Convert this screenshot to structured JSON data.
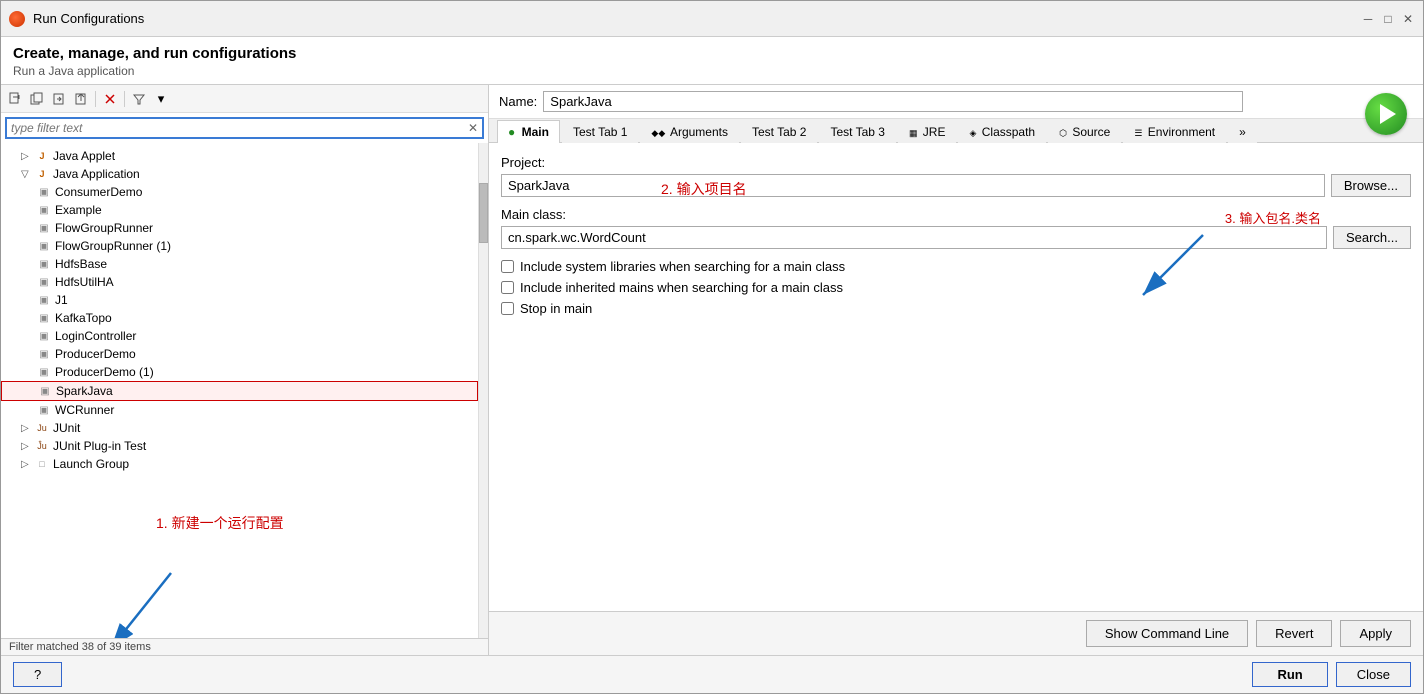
{
  "window": {
    "title": "Run Configurations",
    "header_title": "Create, manage, and run configurations",
    "header_sub": "Run a Java application"
  },
  "toolbar": {
    "new_label": "New",
    "duplicate_label": "Duplicate",
    "import_label": "Import",
    "export_label": "Export",
    "delete_label": "Delete",
    "filter_label": "Filter"
  },
  "search": {
    "placeholder": "type filter text",
    "value": "type filter text"
  },
  "tree": {
    "items": [
      {
        "id": "java-applet",
        "label": "Java Applet",
        "indent": 1,
        "type": "group",
        "expanded": false
      },
      {
        "id": "java-application",
        "label": "Java Application",
        "indent": 1,
        "type": "group",
        "expanded": true
      },
      {
        "id": "consumer-demo",
        "label": "ConsumerDemo",
        "indent": 2,
        "type": "item"
      },
      {
        "id": "example",
        "label": "Example",
        "indent": 2,
        "type": "item"
      },
      {
        "id": "flow-group-runner",
        "label": "FlowGroupRunner",
        "indent": 2,
        "type": "item"
      },
      {
        "id": "flow-group-runner-1",
        "label": "FlowGroupRunner (1)",
        "indent": 2,
        "type": "item"
      },
      {
        "id": "hdfs-base",
        "label": "HdfsBase",
        "indent": 2,
        "type": "item"
      },
      {
        "id": "hdfs-util-ha",
        "label": "HdfsUtilHA",
        "indent": 2,
        "type": "item"
      },
      {
        "id": "j1",
        "label": "J1",
        "indent": 2,
        "type": "item"
      },
      {
        "id": "kafka-topo",
        "label": "KafkaTopo",
        "indent": 2,
        "type": "item"
      },
      {
        "id": "login-controller",
        "label": "LoginController",
        "indent": 2,
        "type": "item"
      },
      {
        "id": "producer-demo",
        "label": "ProducerDemo",
        "indent": 2,
        "type": "item"
      },
      {
        "id": "producer-demo-1",
        "label": "ProducerDemo (1)",
        "indent": 2,
        "type": "item"
      },
      {
        "id": "spark-java",
        "label": "SparkJava",
        "indent": 2,
        "type": "item",
        "selected": true
      },
      {
        "id": "wc-runner",
        "label": "WCRunner",
        "indent": 2,
        "type": "item"
      },
      {
        "id": "junit",
        "label": "JUnit",
        "indent": 1,
        "type": "group",
        "expanded": false
      },
      {
        "id": "junit-plugin-test",
        "label": "JUnit Plug-in Test",
        "indent": 1,
        "type": "group",
        "expanded": false
      },
      {
        "id": "launch-group",
        "label": "Launch Group",
        "indent": 1,
        "type": "group",
        "expanded": false
      }
    ],
    "status": "Filter matched 38 of 39 items"
  },
  "config": {
    "name_label": "Name:",
    "name_value": "SparkJava",
    "tabs": [
      {
        "id": "main",
        "label": "Main",
        "icon": "●",
        "active": true
      },
      {
        "id": "test-tab1",
        "label": "Test Tab 1",
        "active": false
      },
      {
        "id": "arguments",
        "label": "◆◆ Arguments",
        "active": false
      },
      {
        "id": "test-tab2",
        "label": "Test Tab 2",
        "active": false
      },
      {
        "id": "test-tab3",
        "label": "Test Tab 3",
        "active": false
      },
      {
        "id": "jre",
        "label": "▦ JRE",
        "active": false
      },
      {
        "id": "classpath",
        "label": "◈ Classpath",
        "active": false
      },
      {
        "id": "source",
        "label": "⬡ Source",
        "active": false
      },
      {
        "id": "environment",
        "label": "☰ Environment",
        "active": false
      },
      {
        "id": "more",
        "label": "»",
        "active": false
      }
    ],
    "project_label": "Project:",
    "project_value": "SparkJava",
    "project_annotation": "2. 输入项目名",
    "browse_label": "Browse...",
    "main_class_label": "Main class:",
    "main_class_value": "cn.spark.wc.WordCount",
    "main_class_annotation": "3. 输入包名.类名",
    "search_label": "Search...",
    "checkboxes": [
      {
        "id": "include-system",
        "label": "Include system libraries when searching for a main class",
        "checked": false
      },
      {
        "id": "include-inherited",
        "label": "Include inherited mains when searching for a main class",
        "checked": false
      },
      {
        "id": "stop-in-main",
        "label": "Stop in main",
        "checked": false
      }
    ]
  },
  "bottom_buttons": {
    "show_command_line": "Show Command Line",
    "revert": "Revert",
    "apply": "Apply"
  },
  "footer": {
    "help_icon": "?",
    "run_label": "Run",
    "close_label": "Close"
  },
  "annotation_tree": "1. 新建一个运行配置"
}
